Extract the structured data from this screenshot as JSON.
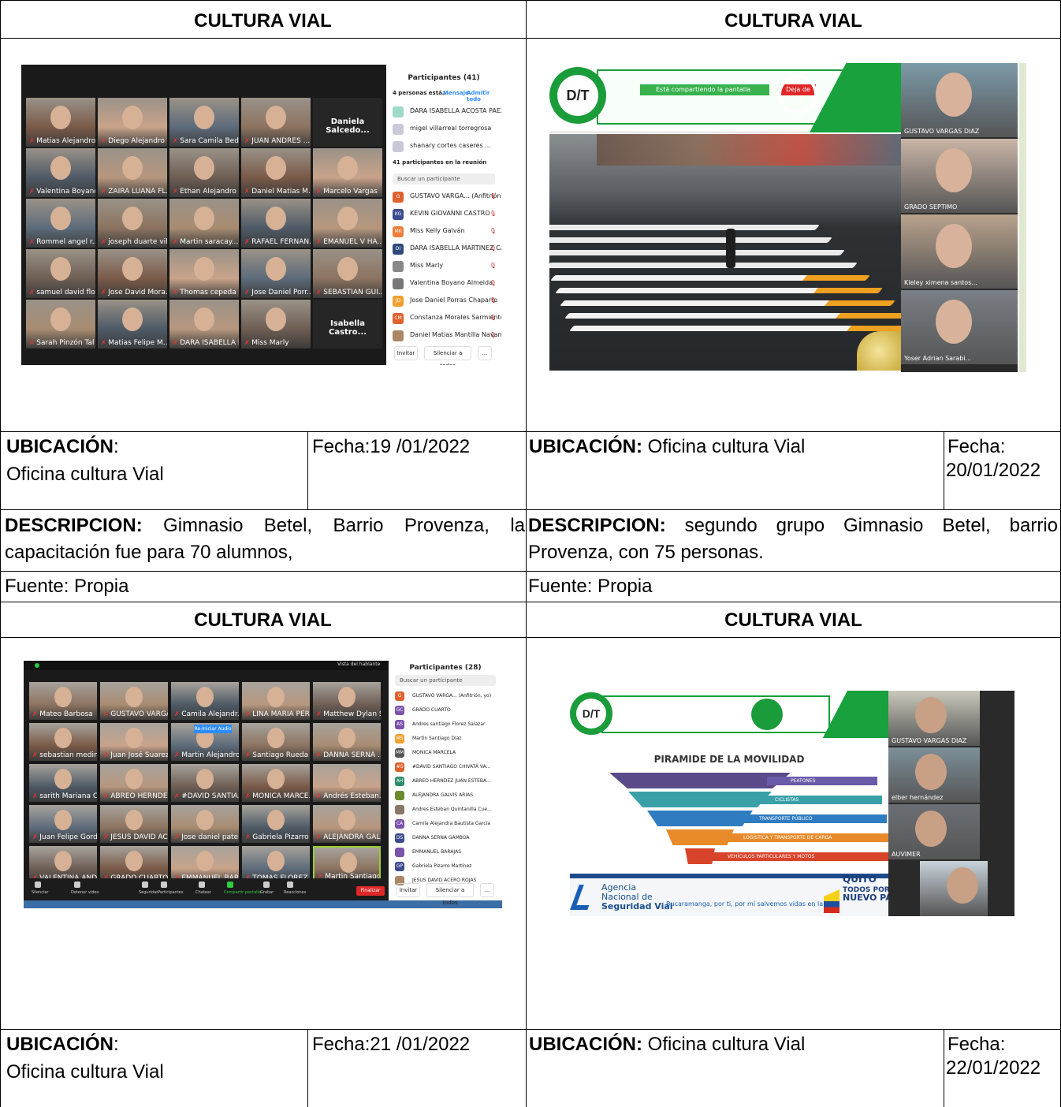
{
  "sections": [
    {
      "left": {
        "header": "CULTURA VIAL",
        "ubicacion_label": "UBICACIÓN",
        "ubicacion_sep": ":",
        "ubicacion_value": "Oficina cultura Vial",
        "fecha": "Fecha:19 /01/2022",
        "descripcion_label": "DESCRIPCION:",
        "descripcion_text": " Gimnasio Betel, Barrio Provenza, la capacitación fue para 70 alumnos,",
        "fuente": "Fuente: Propia"
      },
      "right": {
        "header": "CULTURA VIAL",
        "ubicacion_label": "UBICACIÓN:",
        "ubicacion_value": " Oficina cultura Vial",
        "fecha_label": "Fecha:",
        "fecha_value": "20/01/2022",
        "descripcion_label": "DESCRIPCION:",
        "descripcion_text": " segundo grupo Gimnasio Betel, barrio Provenza, con 75 personas.",
        "fuente": "Fuente: Propia"
      }
    },
    {
      "left": {
        "header": "CULTURA VIAL",
        "ubicacion_label": "UBICACIÓN",
        "ubicacion_sep": ":",
        "ubicacion_value": "Oficina cultura Vial",
        "fecha": "Fecha:21 /01/2022"
      },
      "right": {
        "header": "CULTURA VIAL",
        "ubicacion_label": "UBICACIÓN:",
        "ubicacion_value": " Oficina cultura Vial",
        "fecha_label": "Fecha:",
        "fecha_value": "22/01/2022"
      }
    }
  ],
  "photo1": {
    "panel_title": "Participantes (41)",
    "waiting": "4 personas está...",
    "message": "Mensaje",
    "admit_all": "Admitir todo",
    "waiting_names": [
      "DARA ISABELLA ACOSTA PAEZ",
      "migel villarreal torregrosa",
      "shanary cortes caseres ..."
    ],
    "in_meeting": "41 participantes en la reunión",
    "search": "Buscar un participante",
    "participants": [
      "GUSTAVO VARGA... (Anfitrión, yo)",
      "KEVIN GIOVANNI CASTRO",
      "Miss Kelly Galván",
      "DARA ISABELLA MARTINEZ CAÑAS",
      "Miss Marly",
      "Valentina Boyano Almeida",
      "Jose Daniel Porras Chaparro",
      "Constanza Morales Sarmiento",
      "Daniel Matias Mantilla Navarro"
    ],
    "invite": "Invitar",
    "mute_all": "Silenciar a todos",
    "tiles": [
      "Matias Alejandro",
      "Diego Alejandro ...",
      "Sara Camila Bed...",
      "JUAN ANDRES ...",
      "Daniela Salcedo...",
      "Valentina Boyano Al...",
      "ZAIRA LUANA FL...",
      "Ethan Alejandro",
      "Daniel Matias M...",
      "Marcelo Vargas",
      "Rommel angel r...",
      "joseph duarte vil...",
      "Martin saracay...",
      "RAFAEL FERNAN...",
      "EMANUEL V HA...",
      "samuel david flo...",
      "Jose David Mora...",
      "Thomas cepeda",
      "Jose Daniel Porr...",
      "SEBASTIAN GUI...",
      "Sarah Pinzón Tal",
      "Matias Felipe M...",
      "DARA ISABELLA MAR...",
      "Miss Marly",
      "Isabella Castro..."
    ]
  },
  "photo2": {
    "sharing": "Está compartiendo la pantalla",
    "stop": "Deja de",
    "names": [
      "GUSTAVO VARGAS DIAZ",
      "GRADO SEPTIMO",
      "Kieley ximena santos...",
      "Yoser Adrian Sarabi..."
    ]
  },
  "photo3": {
    "panel_title": "Participantes (28)",
    "view": "Vista del hablante",
    "search": "Buscar un participante",
    "participants": [
      "GUSTAVO VARGA... (Anfitrión, yo)",
      "GRADO CUARTO",
      "Andres santiago Florez Salazar",
      "Martin Santiago Díaz",
      "MONICA MARCELA",
      "#DAVID SANTIAGO CHIVATÁ VA...",
      "ABREO HERNDEZ JUAN ESTEBA...",
      "ALEJANDRA GALVIS ARIAS",
      "Andres Esteban Quintanilla Cue...",
      "Camila Alejandra Bautista García",
      "DANNA SERNA GAMBOA",
      "EMMANUEL BARAJAS",
      "Gabriela Pizarro Martínez",
      "JESUS DAVID ACERO ROJAS"
    ],
    "invite": "Invitar",
    "mute_all": "Silenciar a todos",
    "end": "Finalizar",
    "toolbar": [
      "Silenciar",
      "Detener video",
      "Seguridad",
      "Participantes",
      "Chatear",
      "Compartir pantalla",
      "Grabar",
      "Reacciones"
    ],
    "tiles": [
      "Mateo Barbosa",
      "GUSTAVO VARGAS",
      "Camila Alejandr...",
      "LINA MARIA PER...",
      "Matthew Dylan S...",
      "sebastian medin...",
      "Juan José Suarez...",
      "Martin Alejandro",
      "Santiago Rueda ...",
      "DANNA SERNA ...",
      "sarith Mariana C...",
      "ABREO HERNDE...",
      "#DAVID SANTIA...",
      "MONICA MARCE...",
      "Andrés Esteban...",
      "Juan Felipe Gord...",
      "JESUS DAVID AC...",
      "Jose daniel pate...",
      "Gabriela Pizarro",
      "ALEJANDRA GAL...",
      "VALENTINA AND...",
      "GRADO CUARTO",
      "EMMANUEL BAR...",
      "TOMAS FLOREZ...",
      "Martin Santiago ..."
    ],
    "reiniciar": "Re-Iniciar Audio"
  },
  "photo4": {
    "slide_title": "PIRAMIDE DE LA MOVILIDAD",
    "levels": [
      "PEATONES",
      "CICLISTAS",
      "TRANSPORTE PÚBLICO",
      "LOGÍSTICA Y TRANSPORTE DE CARGA",
      "VEHÍCULOS PARTICULARES Y MOTOS"
    ],
    "agency1": "Agencia",
    "agency2": "Nacional de",
    "agency3": "Seguridad Vial",
    "slogan": "Bucaramanga, por ti, por mí salvemos vidas en la vía.",
    "quito": "QUITO",
    "nuevo1": "TODOS POR UN",
    "nuevo2": "NUEVO PAÍS",
    "names": [
      "GUSTAVO VARGAS DIAZ",
      "elber hernández",
      "AUVIMER"
    ]
  }
}
